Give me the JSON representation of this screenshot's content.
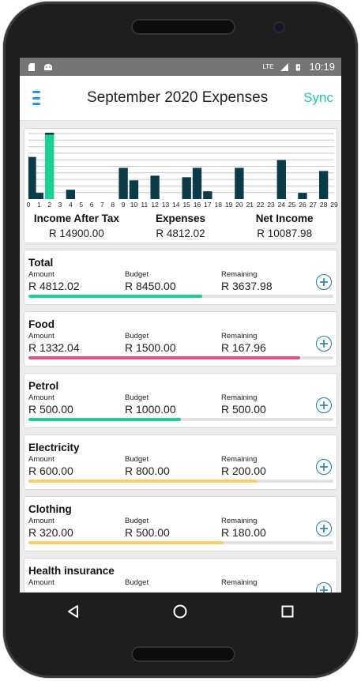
{
  "status_bar": {
    "time": "10:19",
    "network": "LTE"
  },
  "app_bar": {
    "title": "September 2020 Expenses",
    "sync_label": "Sync"
  },
  "chart_data": {
    "type": "bar",
    "categories": [
      "0",
      "1",
      "2",
      "3",
      "4",
      "5",
      "6",
      "7",
      "8",
      "9",
      "10",
      "11",
      "12",
      "13",
      "14",
      "15",
      "16",
      "17",
      "18",
      "19",
      "20",
      "21",
      "22",
      "23",
      "24",
      "25",
      "26",
      "27",
      "28",
      "29"
    ],
    "series": [
      {
        "values": [
          27,
          4,
          42,
          0,
          6,
          0,
          0,
          0,
          0,
          20,
          12,
          0,
          15,
          0,
          0,
          14,
          20,
          5,
          0,
          0,
          20,
          0,
          0,
          0,
          25,
          0,
          4,
          0,
          18,
          0
        ]
      }
    ],
    "highlight_index": 2,
    "colors": {
      "bar": "#0b3a48",
      "highlight": "#1ccf96",
      "grid": "#c9c9c9"
    },
    "grid": true
  },
  "summary": {
    "income_label": "Income After Tax",
    "income_value": "R 14900.00",
    "expenses_label": "Expenses",
    "expenses_value": "R 4812.02",
    "net_label": "Net Income",
    "net_value": "R 10087.98"
  },
  "labels": {
    "amount": "Amount",
    "budget": "Budget",
    "remaining": "Remaining"
  },
  "categories": [
    {
      "name": "Total",
      "amount": "R 4812.02",
      "budget": "R 8450.00",
      "remaining": "R 3637.98",
      "progress": 0.57,
      "color": "#1ccf96"
    },
    {
      "name": "Food",
      "amount": "R 1332.04",
      "budget": "R 1500.00",
      "remaining": "R 167.96",
      "progress": 0.89,
      "color": "#e0507a"
    },
    {
      "name": "Petrol",
      "amount": "R 500.00",
      "budget": "R 1000.00",
      "remaining": "R 500.00",
      "progress": 0.5,
      "color": "#1ccf96"
    },
    {
      "name": "Electricity",
      "amount": "R 600.00",
      "budget": "R 800.00",
      "remaining": "R 200.00",
      "progress": 0.75,
      "color": "#f7cf6a"
    },
    {
      "name": "Clothing",
      "amount": "R 320.00",
      "budget": "R 500.00",
      "remaining": "R 180.00",
      "progress": 0.64,
      "color": "#f7cf6a"
    },
    {
      "name": "Health insurance",
      "amount": "",
      "budget": "",
      "remaining": "",
      "progress": 0,
      "color": "#1ccf96"
    }
  ]
}
